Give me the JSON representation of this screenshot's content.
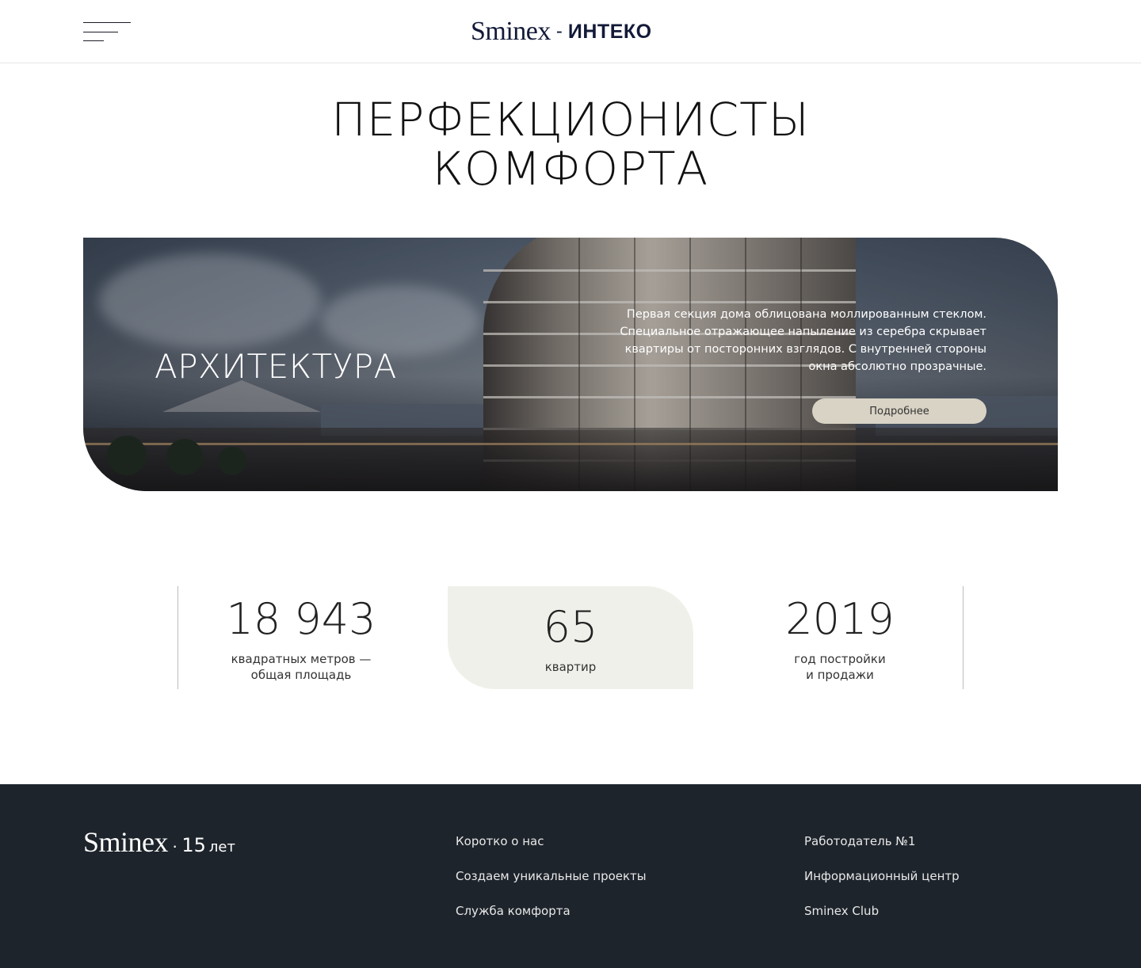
{
  "header": {
    "logo_primary": "Sminex",
    "logo_dash": "-",
    "logo_secondary": "ИНТЕКО"
  },
  "hero": {
    "title_line1": "ПЕРФЕКЦИОНИСТЫ",
    "title_line2": "КОМФОРТА"
  },
  "banner": {
    "heading": "АРХИТЕКТУРА",
    "description_line1": "Первая секция дома облицована моллированным стеклом.",
    "description_line2": "Специальное отражающее напыление из серебра скрывает",
    "description_line3": "квартиры от посторонних взглядов. С внутренней стороны",
    "description_line4": "окна абсолютно прозрачные.",
    "button_label": "Подробнее"
  },
  "stats": [
    {
      "number": "18 943",
      "label_line1": "квадратных метров —",
      "label_line2": "общая площадь"
    },
    {
      "number": "65",
      "label_line1": "квартир",
      "label_line2": ""
    },
    {
      "number": "2019",
      "label_line1": "год постройки",
      "label_line2": "и продажи"
    }
  ],
  "footer": {
    "logo_primary": "Sminex",
    "logo_dot": "·",
    "logo_years": "15",
    "logo_suffix": "лет",
    "col1": [
      "Коротко о нас",
      "Создаем уникальные проекты",
      "Служба комфорта"
    ],
    "col2": [
      "Работодатель №1",
      "Информационный центр",
      "Sminex Club"
    ]
  },
  "colors": {
    "footer_bg": "#1e242c",
    "button_bg": "#d8d3c5",
    "stat_highlight_bg": "#f0f0eb",
    "logo_color": "#131a38"
  }
}
